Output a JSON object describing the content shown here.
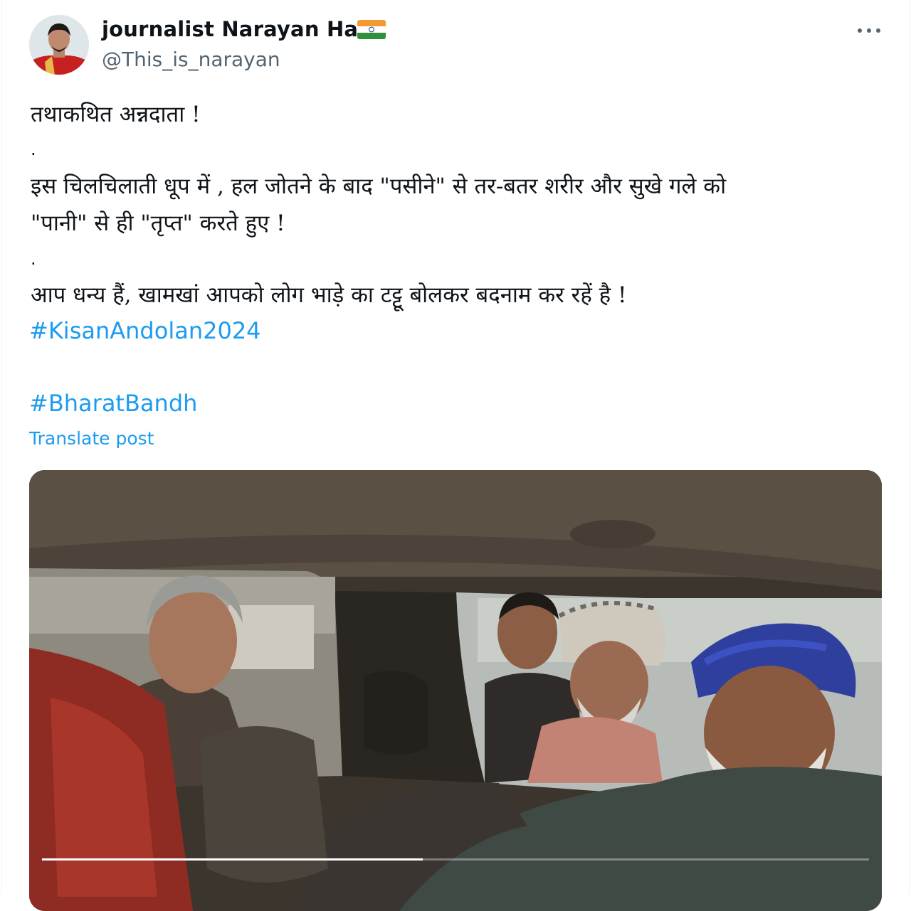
{
  "author": {
    "display_name": "journalist Narayan Hari",
    "handle": "@This_is_narayan",
    "flag_icon": "india-flag-icon"
  },
  "more_icon": "more-options-icon",
  "post": {
    "lines": [
      "तथाकथित अन्नदाता !",
      ".",
      "इस चिलचिलाती धूप में , हल जोतने के बाद \"पसीने\" से तर-बतर शरीर और सुखे गले को",
      "\"पानी\" से ही \"तृप्त\" करते हुए !",
      ".",
      "आप धन्य हैं, खामखां आपको लोग भाड़े का टट्टू बोलकर बदनाम कर रहें है !"
    ],
    "hashtags": [
      "#KisanAndolan2024",
      "#BharatBandh"
    ],
    "translate_label": "Translate post"
  },
  "media": {
    "type": "video",
    "progress": 0.46
  },
  "colors": {
    "link": "#1d9bf0",
    "text": "#0f1419",
    "secondary": "#536471"
  }
}
